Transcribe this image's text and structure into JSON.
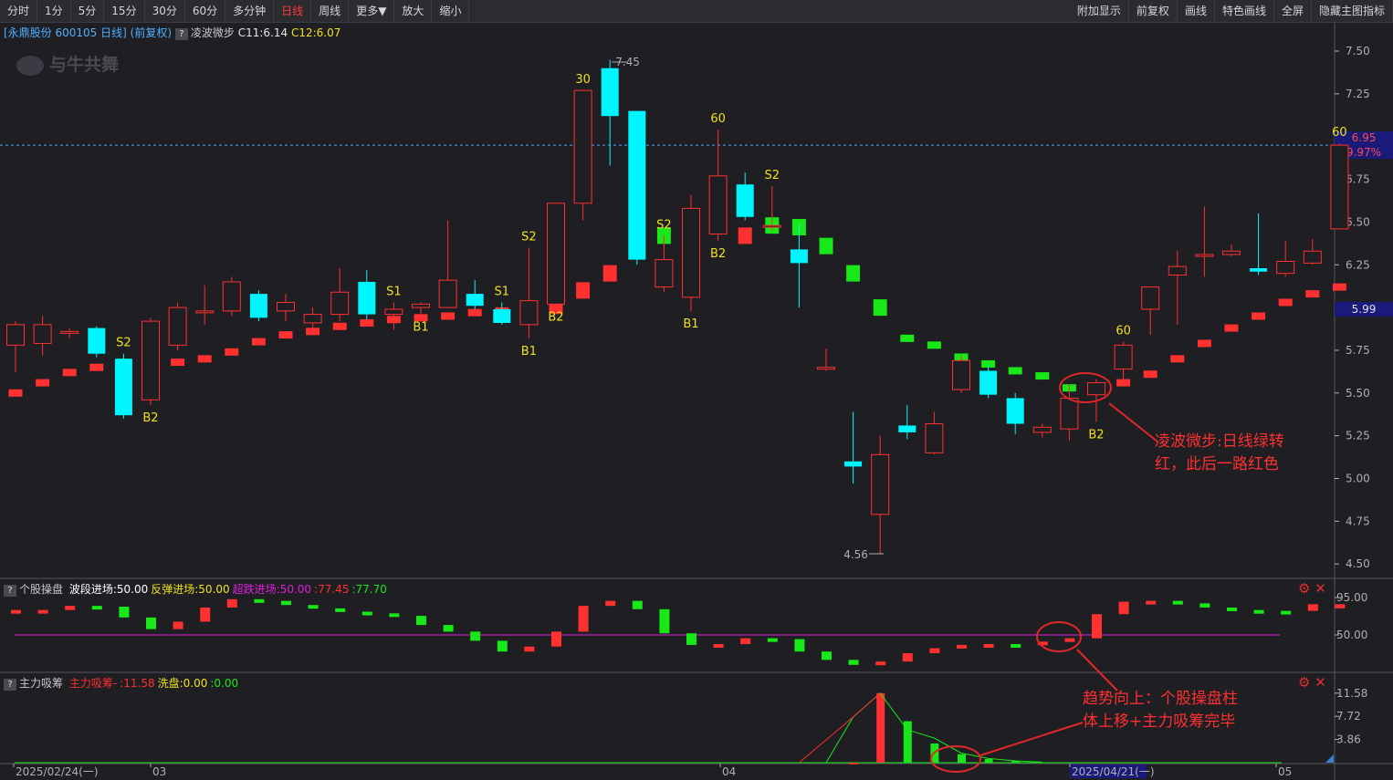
{
  "toolbar": {
    "left": [
      "分时",
      "1分",
      "5分",
      "15分",
      "30分",
      "60分",
      "多分钟",
      "日线",
      "周线",
      "更多▼",
      "放大",
      "缩小"
    ],
    "active_index": 7,
    "right": [
      "附加显示",
      "前复权",
      "画线",
      "特色画线",
      "全屏",
      "隐藏主图指标"
    ]
  },
  "header": {
    "stock": "[永鼎股份 600105 日线]",
    "adj": "(前复权)",
    "q": "?",
    "indicator": "凌波微步",
    "c11": "C11:6.14",
    "c12": "C12:6.07"
  },
  "watermark": "与牛共舞",
  "colors": {
    "up": "#ff3030",
    "down": "#00f5ff",
    "green": "#18e818",
    "yellow": "#f0e020",
    "magenta": "#e020e0",
    "axis": "#b0b0b0"
  },
  "price_axis": {
    "ticks": [
      "7.50",
      "7.25",
      "7.00",
      "6.75",
      "6.50",
      "6.25",
      "6.00",
      "5.75",
      "5.50",
      "5.25",
      "5.00",
      "4.75",
      "4.50"
    ],
    "current_price": "6.95",
    "current_pct": "9.97%",
    "c_line_value": "5.99"
  },
  "extremes": {
    "high": "7.45",
    "low": "4.56"
  },
  "chart_data": {
    "type": "candlestick",
    "dates_shown": [
      "2025/02/24(一)",
      "03",
      "04",
      "2025/04/21(一)",
      "05"
    ],
    "candles": [
      [
        5.78,
        5.9,
        5.62,
        5.92
      ],
      [
        5.79,
        5.9,
        5.72,
        5.95
      ],
      [
        5.85,
        5.86,
        5.82,
        5.88
      ],
      [
        5.88,
        5.73,
        5.71,
        5.89
      ],
      [
        5.7,
        5.37,
        5.35,
        5.73
      ],
      [
        5.46,
        5.92,
        5.43,
        5.94
      ],
      [
        5.78,
        6.0,
        5.75,
        6.03
      ],
      [
        5.97,
        5.98,
        5.9,
        6.13
      ],
      [
        5.98,
        6.15,
        5.95,
        6.18
      ],
      [
        6.08,
        5.94,
        5.92,
        6.1
      ],
      [
        5.98,
        6.03,
        5.92,
        6.08
      ],
      [
        5.91,
        5.96,
        5.87,
        6.0
      ],
      [
        5.96,
        6.09,
        5.92,
        6.23
      ],
      [
        6.15,
        5.96,
        5.93,
        6.22
      ],
      [
        5.96,
        5.99,
        5.87,
        6.03
      ],
      [
        6.0,
        6.02,
        5.96,
        6.03
      ],
      [
        6.0,
        6.16,
        6.0,
        6.51
      ],
      [
        6.08,
        6.01,
        5.99,
        6.16
      ],
      [
        5.99,
        5.91,
        5.9,
        6.03
      ],
      [
        5.9,
        6.04,
        5.82,
        6.35
      ],
      [
        6.02,
        6.61,
        6.02,
        6.61
      ],
      [
        6.61,
        7.27,
        6.51,
        7.27
      ],
      [
        7.4,
        7.12,
        6.83,
        7.45
      ],
      [
        7.15,
        6.28,
        6.25,
        7.09
      ],
      [
        6.12,
        6.28,
        6.09,
        6.42
      ],
      [
        6.06,
        6.58,
        5.98,
        6.66
      ],
      [
        6.43,
        6.77,
        6.39,
        7.04
      ],
      [
        6.72,
        6.53,
        6.51,
        6.79
      ],
      [
        6.48,
        6.48,
        6.45,
        6.71
      ],
      [
        6.34,
        6.26,
        6.0,
        6.49
      ],
      [
        5.65,
        5.65,
        5.63,
        5.76
      ],
      [
        5.1,
        5.07,
        4.97,
        5.39
      ],
      [
        4.79,
        5.14,
        4.56,
        5.25
      ],
      [
        5.31,
        5.27,
        5.23,
        5.43
      ],
      [
        5.15,
        5.32,
        5.14,
        5.39
      ],
      [
        5.52,
        5.69,
        5.5,
        5.72
      ],
      [
        5.63,
        5.49,
        5.47,
        5.66
      ],
      [
        5.47,
        5.32,
        5.26,
        5.5
      ],
      [
        5.27,
        5.3,
        5.24,
        5.32
      ],
      [
        5.29,
        5.47,
        5.22,
        5.55
      ],
      [
        5.49,
        5.56,
        5.33,
        5.58
      ],
      [
        5.64,
        5.78,
        5.55,
        5.8
      ],
      [
        5.99,
        6.12,
        5.84,
        6.12
      ],
      [
        6.19,
        6.24,
        5.9,
        6.33
      ],
      [
        6.31,
        6.31,
        6.18,
        6.59
      ],
      [
        6.31,
        6.33,
        6.3,
        6.37
      ],
      [
        6.23,
        6.21,
        6.19,
        6.55
      ],
      [
        6.2,
        6.27,
        6.18,
        6.39
      ],
      [
        6.26,
        6.33,
        6.25,
        6.4
      ],
      [
        6.46,
        6.95,
        6.46,
        6.96
      ]
    ],
    "indicator_line": [
      [
        5.5,
        "r"
      ],
      [
        5.56,
        "r"
      ],
      [
        5.62,
        "r"
      ],
      [
        5.65,
        "r"
      ],
      [
        5.68,
        "g"
      ],
      [
        5.68,
        "r"
      ],
      [
        5.68,
        "r"
      ],
      [
        5.7,
        "r"
      ],
      [
        5.74,
        "r"
      ],
      [
        5.8,
        "r"
      ],
      [
        5.84,
        "r"
      ],
      [
        5.86,
        "r"
      ],
      [
        5.89,
        "r"
      ],
      [
        5.91,
        "r"
      ],
      [
        5.93,
        "r"
      ],
      [
        5.94,
        "r"
      ],
      [
        5.95,
        "r"
      ],
      [
        5.97,
        "r"
      ],
      [
        5.98,
        "r"
      ],
      [
        6.0,
        "g"
      ],
      [
        6.01,
        "r"
      ],
      [
        6.1,
        "r"
      ],
      [
        6.2,
        "r"
      ],
      [
        6.33,
        "r"
      ],
      [
        6.42,
        "g"
      ],
      [
        6.42,
        "g"
      ],
      [
        6.48,
        "r"
      ],
      [
        6.42,
        "r"
      ],
      [
        6.48,
        "g"
      ],
      [
        6.47,
        "g"
      ],
      [
        6.36,
        "g"
      ],
      [
        6.2,
        "g"
      ],
      [
        6.0,
        "g"
      ],
      [
        5.82,
        "g"
      ],
      [
        5.78,
        "g"
      ],
      [
        5.71,
        "g"
      ],
      [
        5.67,
        "g"
      ],
      [
        5.63,
        "g"
      ],
      [
        5.6,
        "g"
      ],
      [
        5.53,
        "g"
      ],
      [
        5.54,
        "r"
      ],
      [
        5.56,
        "r"
      ],
      [
        5.61,
        "r"
      ],
      [
        5.7,
        "r"
      ],
      [
        5.79,
        "r"
      ],
      [
        5.88,
        "r"
      ],
      [
        5.95,
        "r"
      ],
      [
        6.03,
        "r"
      ],
      [
        6.08,
        "r"
      ],
      [
        6.12,
        "r"
      ]
    ],
    "signals": [
      [
        4,
        "S2",
        "above"
      ],
      [
        5,
        "B2",
        "below"
      ],
      [
        14,
        "S1",
        "above"
      ],
      [
        15,
        "B1",
        "below"
      ],
      [
        18,
        "S1",
        "above"
      ],
      [
        19,
        "S2",
        "above"
      ],
      [
        19,
        "B1",
        "below"
      ],
      [
        20,
        "B2",
        "below"
      ],
      [
        21,
        "30",
        "above"
      ],
      [
        24,
        "S2",
        "above"
      ],
      [
        25,
        "B1",
        "below"
      ],
      [
        26,
        "60",
        "above"
      ],
      [
        26,
        "B2",
        "below"
      ],
      [
        28,
        "S2",
        "above"
      ],
      [
        40,
        "B2",
        "below"
      ],
      [
        41,
        "60",
        "above"
      ],
      [
        49,
        "60",
        "above"
      ]
    ],
    "ind2_values": [
      [
        80,
        "r"
      ],
      [
        80,
        "r"
      ],
      [
        85,
        "r"
      ],
      [
        84,
        "g"
      ],
      [
        71,
        "g"
      ],
      [
        57,
        "g"
      ],
      [
        66,
        "r"
      ],
      [
        83,
        "r"
      ],
      [
        93,
        "r"
      ],
      [
        91,
        "g"
      ],
      [
        86,
        "g"
      ],
      [
        82,
        "g"
      ],
      [
        78,
        "g"
      ],
      [
        76,
        "g"
      ],
      [
        73,
        "g"
      ],
      [
        62,
        "g"
      ],
      [
        54,
        "g"
      ],
      [
        43,
        "g"
      ],
      [
        30,
        "g"
      ],
      [
        36,
        "r"
      ],
      [
        54,
        "r"
      ],
      [
        85,
        "r"
      ],
      [
        91,
        "r"
      ],
      [
        81,
        "g"
      ],
      [
        52,
        "g"
      ],
      [
        38,
        "g"
      ],
      [
        39,
        "r"
      ],
      [
        46,
        "r"
      ],
      [
        45,
        "g"
      ],
      [
        30,
        "g"
      ],
      [
        20,
        "g"
      ],
      [
        14,
        "g"
      ],
      [
        18,
        "r"
      ],
      [
        28,
        "r"
      ],
      [
        34,
        "r"
      ],
      [
        38,
        "r"
      ],
      [
        39,
        "r"
      ],
      [
        38,
        "g"
      ],
      [
        42,
        "r"
      ],
      [
        46,
        "r"
      ],
      [
        75,
        "r"
      ],
      [
        90,
        "r"
      ],
      [
        91,
        "r"
      ],
      [
        88,
        "g"
      ],
      [
        83,
        "g"
      ],
      [
        80,
        "g"
      ],
      [
        79,
        "g"
      ],
      [
        79,
        "g"
      ],
      [
        87,
        "r"
      ],
      [
        82,
        "r"
      ]
    ],
    "ind3_values": [
      [
        31,
        0,
        "r"
      ],
      [
        32,
        11.58,
        "r"
      ],
      [
        33,
        6.91,
        "g"
      ],
      [
        34,
        3.2,
        "g"
      ],
      [
        35,
        1.4,
        "g"
      ],
      [
        36,
        0.6,
        "g"
      ],
      [
        37,
        0.3,
        "g"
      ]
    ],
    "ind3_line": [
      [
        30,
        0
      ],
      [
        31,
        7.6
      ],
      [
        32,
        11.58
      ],
      [
        33,
        5.5
      ],
      [
        34,
        4.1
      ],
      [
        35,
        1.6
      ],
      [
        36,
        0.7
      ],
      [
        37,
        0.3
      ],
      [
        38,
        0.1
      ]
    ]
  },
  "ind2": {
    "title": "个股操盘",
    "fields": [
      {
        "t": "波段进场:50.00",
        "c": "#ffffff"
      },
      {
        "t": "反弹进场:50.00",
        "c": "#f0e020"
      },
      {
        "t": "超跌进场:50.00",
        "c": "#e020e0"
      },
      {
        "t": ":77.45",
        "c": "#ff3030"
      },
      {
        "t": ":77.70",
        "c": "#18e818"
      }
    ],
    "ticks": [
      "95.00",
      "50.00"
    ]
  },
  "ind3": {
    "title": "主力吸筹",
    "fields": [
      {
        "t": "主力吸筹-",
        "c": "#ff3030"
      },
      {
        "t": ":11.58",
        "c": "#ff3030"
      },
      {
        "t": "洗盘:0.00",
        "c": "#f0e020"
      },
      {
        "t": ":0.00",
        "c": "#18e818"
      }
    ],
    "ticks": [
      "11.58",
      "7.72",
      "3.86"
    ]
  },
  "annotations": {
    "a1_line1": "凌波微步:日线绿转",
    "a1_line2": "红，此后一路红色",
    "a2_line1": "趋势向上：个股操盘柱",
    "a2_line2": "体上移+主力吸筹完毕"
  }
}
